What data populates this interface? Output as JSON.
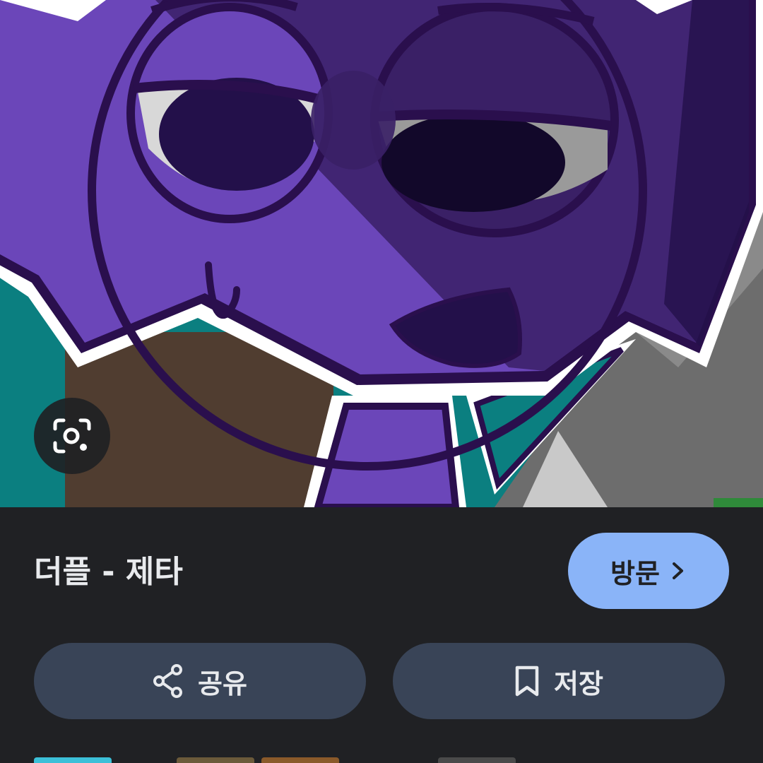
{
  "image_preview": {
    "lens_icon": "google-lens-icon"
  },
  "result": {
    "title": "더플 - 제타",
    "visit_label": "방문",
    "visit_icon": "chevron-right-icon"
  },
  "actions": {
    "share_label": "공유",
    "share_icon": "share-icon",
    "save_label": "저장",
    "save_icon": "bookmark-icon"
  },
  "colors": {
    "panel_bg": "#202124",
    "visit_bg": "#8ab4f8",
    "action_bg": "#394457",
    "text": "#e8eaed"
  }
}
